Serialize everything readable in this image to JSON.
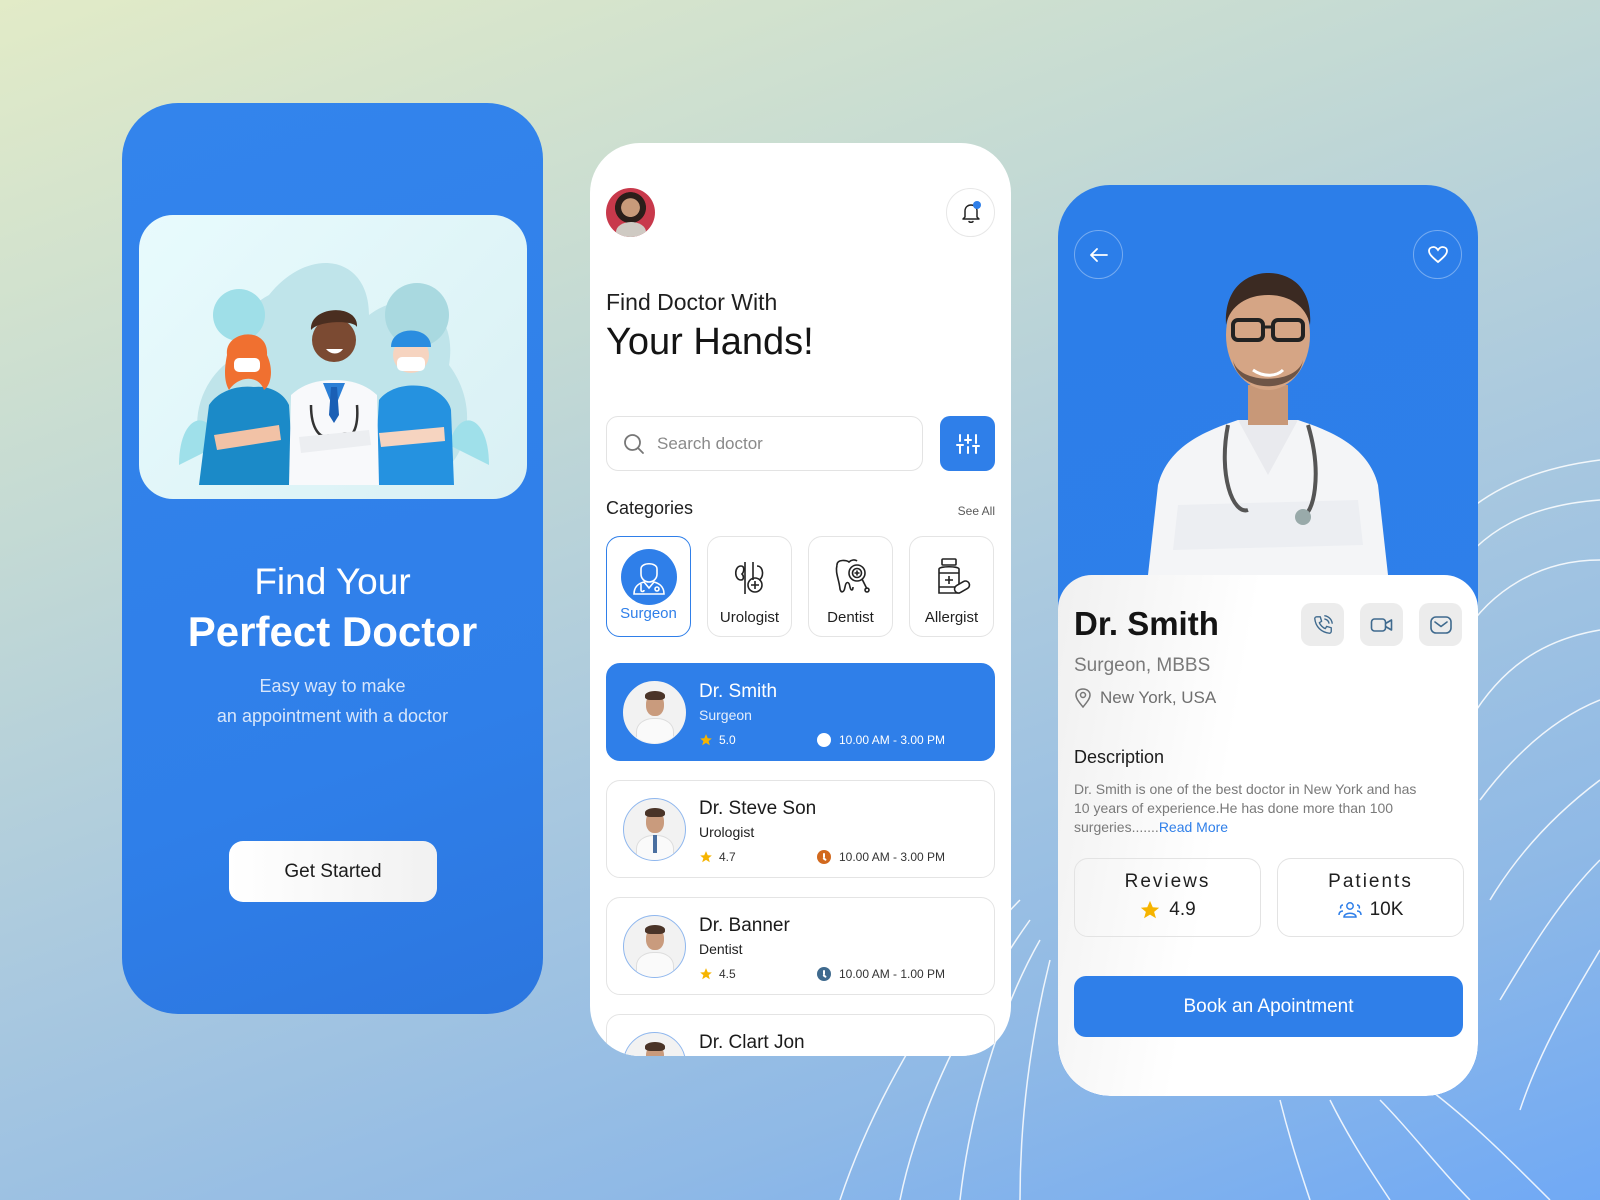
{
  "colors": {
    "brand_blue": "#2f7fe9",
    "star": "#f6b400",
    "clock_orange": "#d2691e",
    "clock_slate": "#3f6a8e"
  },
  "onboarding": {
    "title_line1": "Find Your",
    "title_line2": "Perfect Doctor",
    "subtitle_line1": "Easy way to make",
    "subtitle_line2": "an appointment with a doctor",
    "cta_label": "Get Started",
    "illustration": "medical-team-illustration"
  },
  "home": {
    "heading_line1": "Find Doctor With",
    "heading_line2": "Your Hands!",
    "search_placeholder": "Search doctor",
    "search_value": "",
    "categories_title": "Categories",
    "see_all_label": "See All",
    "categories": [
      {
        "label": "Surgeon",
        "icon": "surgeon-icon",
        "active": true
      },
      {
        "label": "Urologist",
        "icon": "kidney-icon",
        "active": false
      },
      {
        "label": "Dentist",
        "icon": "tooth-icon",
        "active": false
      },
      {
        "label": "Allergist",
        "icon": "medicine-bottle-icon",
        "active": false
      }
    ],
    "doctors": [
      {
        "name": "Dr. Smith",
        "specialty": "Surgeon",
        "rating": "5.0",
        "hours": "10.00 AM - 3.00 PM",
        "active": true
      },
      {
        "name": "Dr. Steve Son",
        "specialty": "Urologist",
        "rating": "4.7",
        "hours": "10.00 AM - 3.00 PM",
        "active": false
      },
      {
        "name": "Dr. Banner",
        "specialty": "Dentist",
        "rating": "4.5",
        "hours": "10.00 AM - 1.00 PM",
        "active": false
      },
      {
        "name": "Dr. Clart Jon",
        "specialty": "",
        "rating": "",
        "hours": "",
        "active": false
      }
    ]
  },
  "detail": {
    "name": "Dr. Smith",
    "specialty": "Surgeon, MBBS",
    "location": "New York, USA",
    "description_title": "Description",
    "description_text": "Dr. Smith is one of the best doctor in New York and has 10 years of experience.He has done more than 100 surgeries.......",
    "read_more_label": "Read More",
    "reviews_label": "Reviews",
    "reviews_value": "4.9",
    "patients_label": "Patients",
    "patients_value": "10K",
    "book_label": "Book an Apointment"
  }
}
